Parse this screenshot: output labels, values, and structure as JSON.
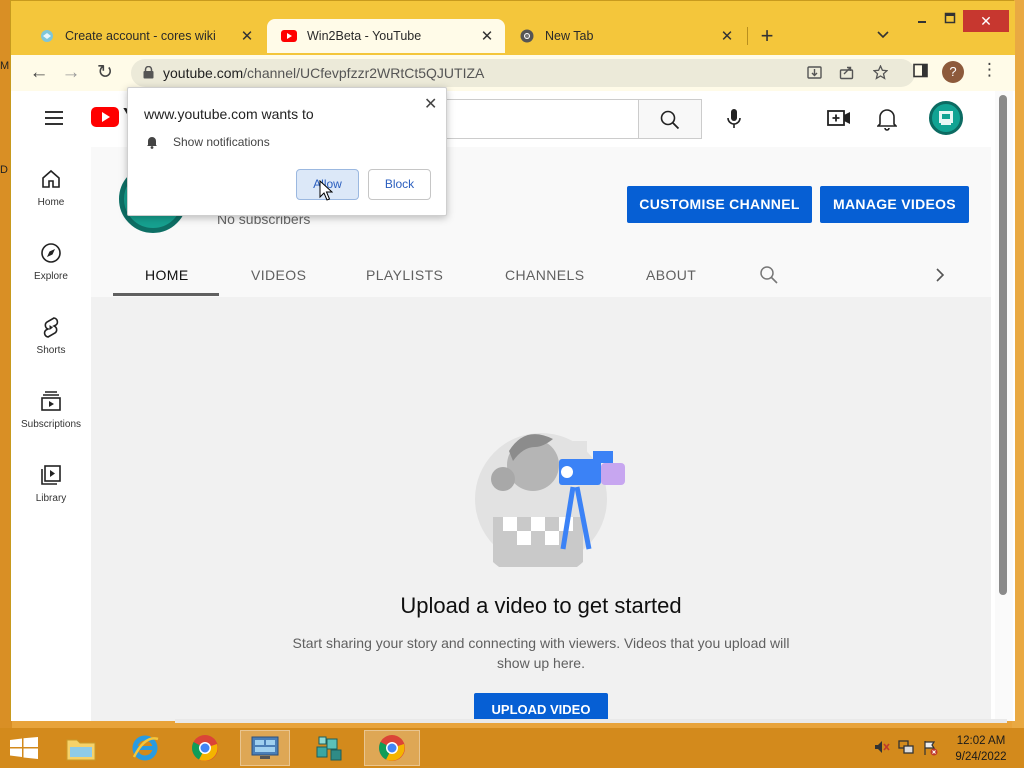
{
  "window": {
    "tabs": [
      {
        "title": "Create account - cores wiki",
        "active": false
      },
      {
        "title": "Win2Beta - YouTube",
        "active": true
      },
      {
        "title": "New Tab",
        "active": false
      }
    ],
    "new_tab_symbol": "+",
    "tab_list_symbol": "⌄",
    "controls": {
      "minimize": "▁",
      "maximize": "▢",
      "close": "✕"
    }
  },
  "toolbar": {
    "url_host": "youtube.com",
    "url_path": "/channel/UCfevpfzzr2WRtCt5QJUTIZA",
    "back_icon": "←",
    "forward_icon": "→",
    "reload_icon": "↻",
    "profile_initial": "?",
    "menu_icon": "⋮"
  },
  "permission_popup": {
    "title": "www.youtube.com wants to",
    "item": "Show notifications",
    "allow_label": "Allow",
    "block_label": "Block",
    "close_symbol": "✕"
  },
  "youtube": {
    "logo_text": "Y",
    "sidebar": [
      {
        "label": "Home",
        "icon": "home-icon"
      },
      {
        "label": "Explore",
        "icon": "compass-icon"
      },
      {
        "label": "Shorts",
        "icon": "shorts-icon"
      },
      {
        "label": "Subscriptions",
        "icon": "subscriptions-icon"
      },
      {
        "label": "Library",
        "icon": "library-icon"
      }
    ],
    "channel": {
      "subscribers": "No subscribers",
      "customise_label": "CUSTOMISE CHANNEL",
      "manage_label": "MANAGE VIDEOS"
    },
    "channel_tabs": [
      "HOME",
      "VIDEOS",
      "PLAYLISTS",
      "CHANNELS",
      "ABOUT"
    ],
    "active_tab": "HOME",
    "empty_state": {
      "title": "Upload a video to get started",
      "subtitle": "Start sharing your story and connecting with viewers. Videos that you upload will show up here.",
      "upload_label": "UPLOAD VIDEO"
    }
  },
  "taskbar": {
    "time": "12:02 AM",
    "date": "9/24/2022"
  },
  "desktop": {
    "edge_letters": [
      "M",
      "D"
    ]
  },
  "colors": {
    "accent_blue": "#065fd4",
    "youtube_red": "#ff0000",
    "window_frame": "#f4c63b",
    "taskbar": "#d38a1c"
  }
}
